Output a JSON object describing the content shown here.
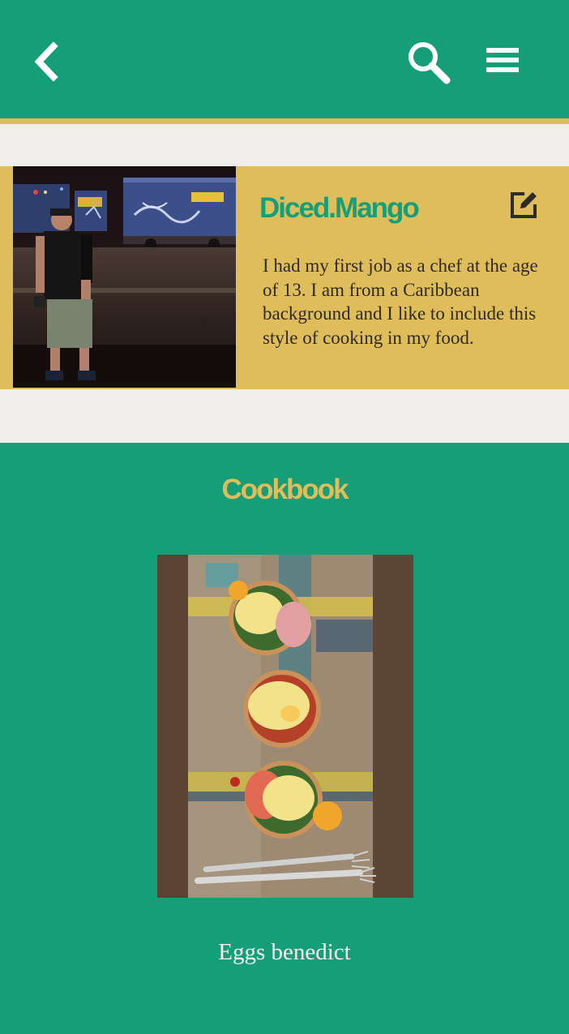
{
  "header": {
    "back_icon": "chevron-left-icon",
    "search_icon": "search-icon",
    "menu_icon": "hamburger-menu-icon",
    "background_color": "#169e79",
    "accent_color": "#dfbd5a"
  },
  "profile": {
    "username": "Diced.Mango",
    "bio": "I had my first job as a chef at the age of 13. I am from a Caribbean background and I like to include this style of cooking in my food.",
    "edit_icon": "edit-icon"
  },
  "cookbook": {
    "title": "Cookbook",
    "recipes": [
      {
        "name": "Eggs benedict"
      }
    ]
  }
}
